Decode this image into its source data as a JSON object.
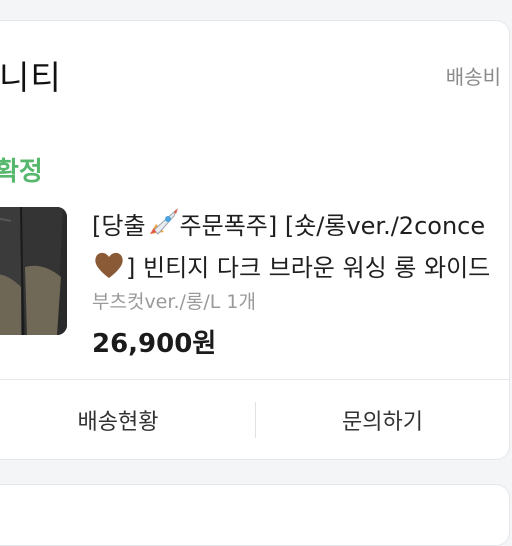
{
  "shop": {
    "name": "니티",
    "shipping_label": "배송비"
  },
  "order": {
    "status": "확정"
  },
  "product": {
    "title_line1_a": "[당출",
    "title_line1_b": "주문폭주] [숏/롱ver./2conce",
    "title_line2": "] 빈티지 다크 브라운 워싱 롱 와이드",
    "option": "부츠컷ver./롱/L 1개",
    "price": "26,900원",
    "image_icon": "jeans-thumbnail",
    "emoji_icons": [
      "rocket-icon",
      "brown-heart-icon"
    ]
  },
  "actions": {
    "track_label": "배송현황",
    "inquiry_label": "문의하기"
  },
  "colors": {
    "status_green": "#56b86c",
    "background": "#f4f5f7",
    "heart_brown": "#8a5a36"
  }
}
